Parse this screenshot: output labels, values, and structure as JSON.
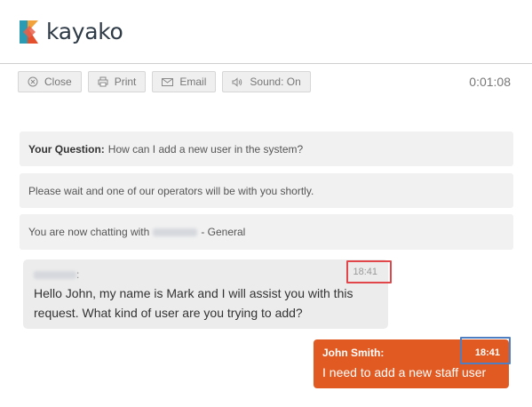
{
  "brand": {
    "name": "kayako"
  },
  "toolbar": {
    "buttons": [
      {
        "label": "Close",
        "icon": "close-circle-icon"
      },
      {
        "label": "Print",
        "icon": "printer-icon"
      },
      {
        "label": "Email",
        "icon": "envelope-icon"
      },
      {
        "label": "Sound: On",
        "icon": "speaker-icon"
      }
    ],
    "timer": "0:01:08"
  },
  "messages": {
    "question_label": "Your Question:",
    "question_text": "How can I add a new user in the system?",
    "wait_text": "Please wait and one of our operators will be with you shortly.",
    "chatting_prefix": "You are now chatting with",
    "chatting_suffix": "- General"
  },
  "operator_message": {
    "name_suffix": ":",
    "time": "18:41",
    "text": "Hello John, my name is Mark and I will assist you with this request. What kind of user are you trying to add?"
  },
  "user_message": {
    "name": "John Smith:",
    "time": "18:41",
    "text": "I need to add a new staff user"
  },
  "colors": {
    "brand_orange": "#e15a22",
    "highlight_red": "#e0464a",
    "highlight_blue": "#4f7ec2"
  }
}
